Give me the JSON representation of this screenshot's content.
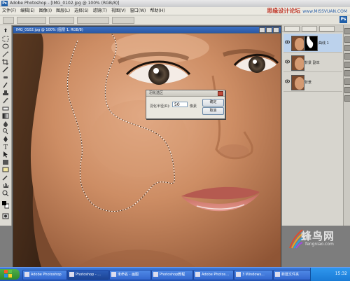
{
  "titlebar": {
    "title": "Adobe Photoshop - [IMG_0102.jpg @ 100% (RGB/8)]"
  },
  "menus": [
    "文件(F)",
    "编辑(E)",
    "图像(I)",
    "图层(L)",
    "选择(S)",
    "滤镜(T)",
    "视图(V)",
    "窗口(W)",
    "帮助(H)"
  ],
  "watermark_top": {
    "text": "思缘设计论坛",
    "url": "www.MISSVUAN.COM"
  },
  "doc": {
    "title": "IMG_0102.jpg @ 100% (图层 1, RGB/8)"
  },
  "dialog": {
    "title": "羽化选区",
    "label": "羽化半径(R):",
    "value": "50",
    "unit": "像素",
    "ok": "确定",
    "cancel": "取消"
  },
  "layers": [
    {
      "name": "曲线 1",
      "selected": true,
      "mask": true
    },
    {
      "name": "背景 副本",
      "selected": false,
      "mask": false
    },
    {
      "name": "背景",
      "selected": false,
      "mask": false
    }
  ],
  "watermark_bottom": {
    "text": "蜂鸟网",
    "url": "fengniao.com"
  },
  "taskbar": {
    "items": [
      "Adobe Photoshop",
      "Photoshop - ...",
      "未命名 - 画图",
      "Photoshop教程",
      "Adobe Photos...",
      "3 Windows...",
      "新建文件夹"
    ],
    "clock": "15:32"
  },
  "colors": {
    "taskbar": "#2456b8",
    "selection_bg": "#bcd2ec",
    "skin": "#c98a62"
  }
}
